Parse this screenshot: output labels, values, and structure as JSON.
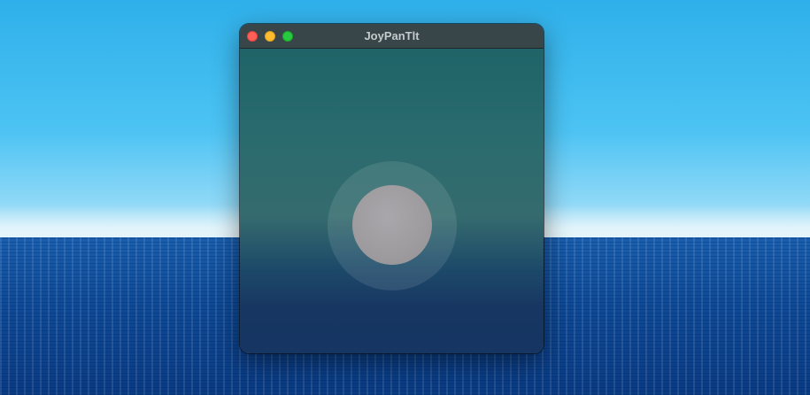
{
  "desktop": {
    "wallpaper_icon": "ocean-horizon-wallpaper"
  },
  "window": {
    "title": "JoyPanTlt",
    "controls": {
      "close_icon": "close-icon",
      "minimize_icon": "minimize-icon",
      "zoom_icon": "zoom-icon",
      "close_color": "#fe5f57",
      "minimize_color": "#febc2e",
      "zoom_color": "#28c840"
    }
  },
  "joystick": {
    "icon": "joystick-knob",
    "position": {
      "x": 0,
      "y": 0
    }
  }
}
